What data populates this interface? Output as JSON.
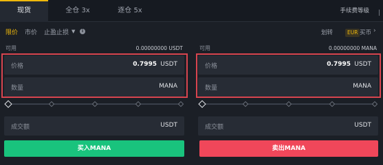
{
  "tabs": [
    {
      "label": "现货"
    },
    {
      "label": "全仓 3x"
    },
    {
      "label": "逐仓 5x"
    }
  ],
  "fee_link": "手续费等级",
  "order_types": {
    "limit": "限价",
    "market": "市价",
    "stop": "止盈止损"
  },
  "right_controls": {
    "transfer": "划转",
    "eur_badge": "EUR",
    "buy_coin": "买币"
  },
  "buy_panel": {
    "available_label": "可用",
    "available_value": "0.00000000 USDT",
    "price_label": "价格",
    "price_value": "0.7995",
    "price_unit": "USDT",
    "amount_label": "数量",
    "amount_unit": "MANA",
    "total_label": "成交额",
    "total_unit": "USDT",
    "button_label": "买入MANA"
  },
  "sell_panel": {
    "available_label": "可用",
    "available_value": "0.00000000 MANA",
    "price_label": "价格",
    "price_value": "0.7995",
    "price_unit": "USDT",
    "amount_label": "数量",
    "amount_unit": "MANA",
    "total_label": "成交额",
    "total_unit": "USDT",
    "button_label": "卖出MANA"
  },
  "colors": {
    "accent": "#f0b90b",
    "buy": "#19c37d",
    "sell": "#f0475a",
    "highlight_border": "#d9454f"
  }
}
